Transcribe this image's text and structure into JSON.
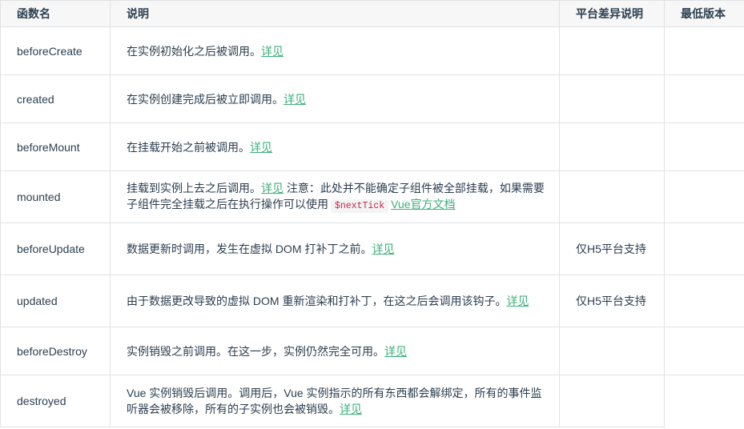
{
  "table": {
    "headers": {
      "name": "函数名",
      "desc": "说明",
      "platform": "平台差异说明",
      "version": "最低版本"
    },
    "rows": [
      {
        "name": "beforeCreate",
        "desc": "在实例初始化之后被调用。",
        "link": "详见",
        "platform": ""
      },
      {
        "name": "created",
        "desc": "在实例创建完成后被立即调用。",
        "link": "详见",
        "platform": ""
      },
      {
        "name": "beforeMount",
        "desc": "在挂载开始之前被调用。",
        "link": "详见",
        "platform": ""
      },
      {
        "name": "mounted",
        "desc": "挂载到实例上去之后调用。",
        "link": "详见",
        "note": " 注意：此处并不能确定子组件被全部挂载，如果需要子组件完全挂载之后在执行操作可以使用",
        "code": "$nextTick",
        "link2": "Vue官方文档",
        "platform": ""
      },
      {
        "name": "beforeUpdate",
        "desc": "数据更新时调用，发生在虚拟 DOM 打补丁之前。",
        "link": "详见",
        "platform": "仅H5平台支持"
      },
      {
        "name": "updated",
        "desc": "由于数据更改导致的虚拟 DOM 重新渲染和打补丁，在这之后会调用该钩子。",
        "link": "详见",
        "platform": "仅H5平台支持"
      },
      {
        "name": "beforeDestroy",
        "desc": "实例销毁之前调用。在这一步，实例仍然完全可用。",
        "link": "详见",
        "platform": ""
      },
      {
        "name": "destroyed",
        "desc": "Vue 实例销毁后调用。调用后，Vue 实例指示的所有东西都会解绑定，所有的事件监听器会被移除，所有的子实例也会被销毁。",
        "link": "详见",
        "platform": ""
      }
    ]
  },
  "colors": {
    "link": "#3eaf7c",
    "border": "#dfe2e5",
    "header_bg": "#f7f7f7",
    "code": "#c7254e"
  }
}
